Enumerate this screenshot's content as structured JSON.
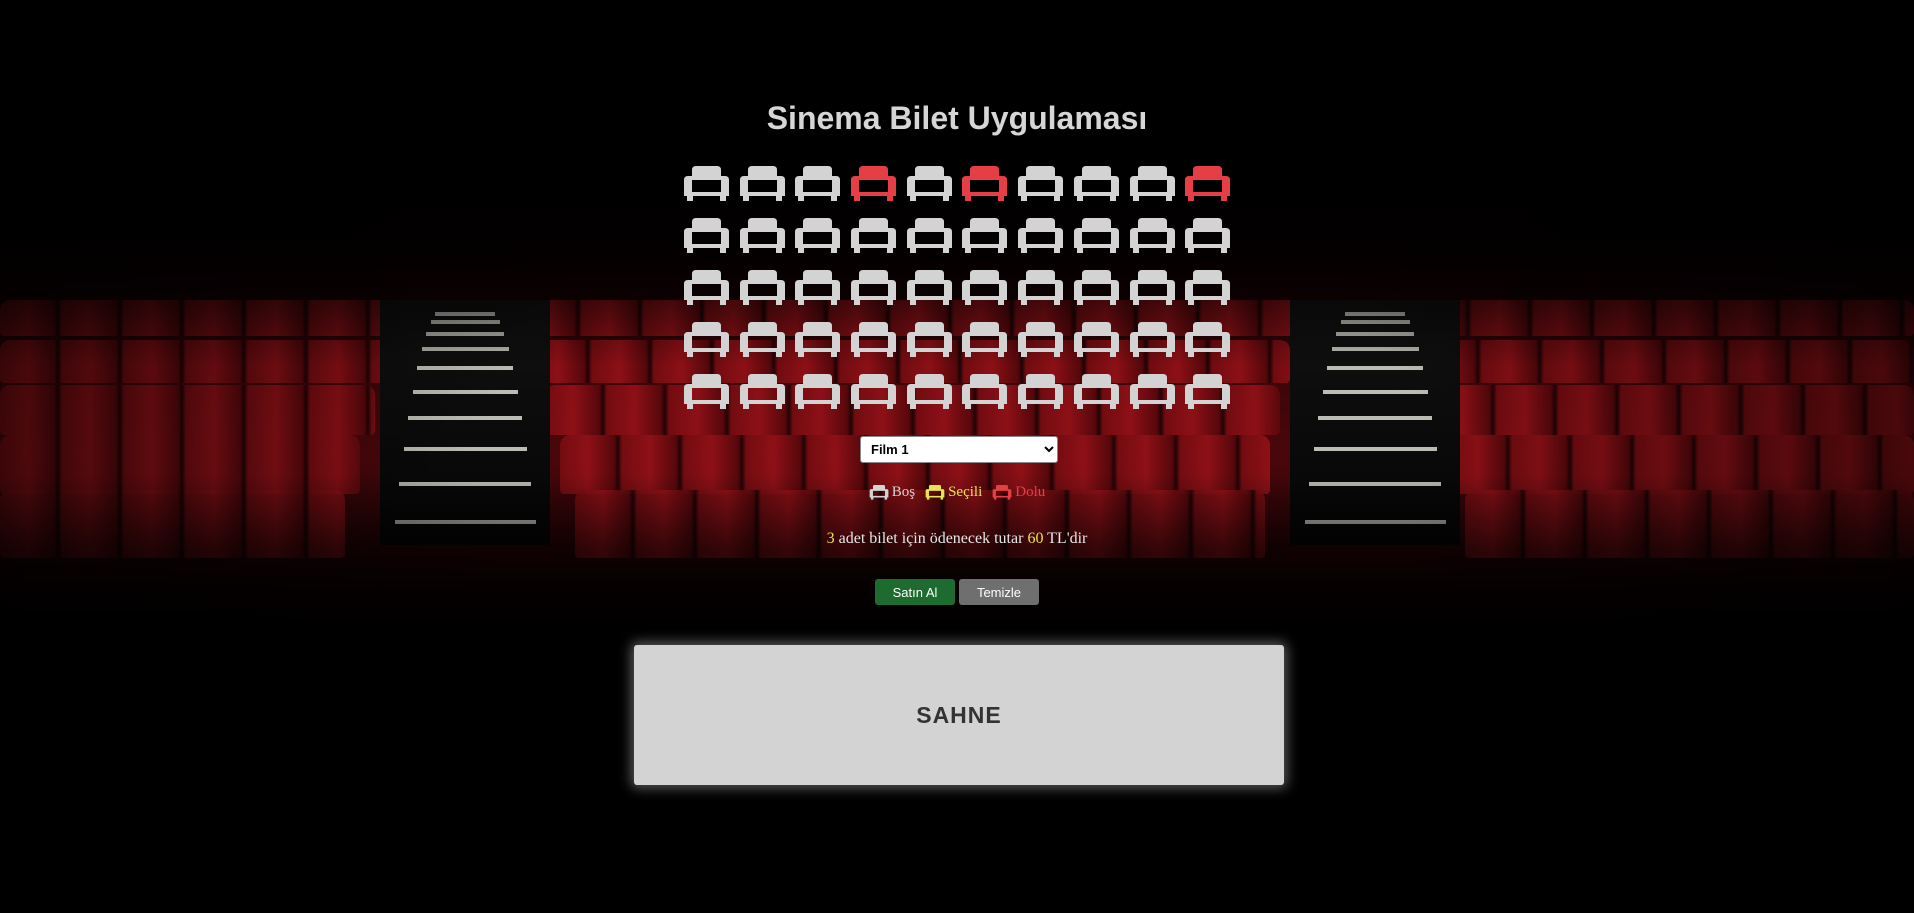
{
  "app": {
    "title": "Sinema Bilet Uygulaması"
  },
  "colors": {
    "seat_empty": "#d3d3d3",
    "seat_selected": "#e8e354",
    "seat_full": "#e53e45",
    "buy_button": "#1d6b2e",
    "clear_button": "#6f6f6f",
    "stage": "#d3d3d3"
  },
  "seats": {
    "rows": [
      [
        "empty",
        "empty",
        "empty",
        "full",
        "empty",
        "full",
        "empty",
        "empty",
        "empty",
        "full"
      ],
      [
        "empty",
        "empty",
        "empty",
        "empty",
        "empty",
        "empty",
        "empty",
        "empty",
        "empty",
        "empty"
      ],
      [
        "empty",
        "empty",
        "empty",
        "empty",
        "empty",
        "empty",
        "empty",
        "empty",
        "empty",
        "empty"
      ],
      [
        "empty",
        "empty",
        "empty",
        "empty",
        "empty",
        "empty",
        "empty",
        "empty",
        "empty",
        "empty"
      ],
      [
        "empty",
        "empty",
        "empty",
        "empty",
        "empty",
        "empty",
        "empty",
        "empty",
        "empty",
        "empty"
      ]
    ],
    "icon": "couch-icon"
  },
  "movie_select": {
    "selected": "Film 1",
    "options": [
      "Film 1"
    ]
  },
  "legend": {
    "empty": "Boş",
    "selected": "Seçili",
    "full": "Dolu"
  },
  "summary": {
    "count": "3",
    "text_middle": " adet bilet için ödenecek tutar ",
    "amount": "60",
    "text_end": " TL'dir"
  },
  "buttons": {
    "buy": "Satın Al",
    "clear": "Temizle"
  },
  "stage": {
    "label": "SAHNE"
  }
}
